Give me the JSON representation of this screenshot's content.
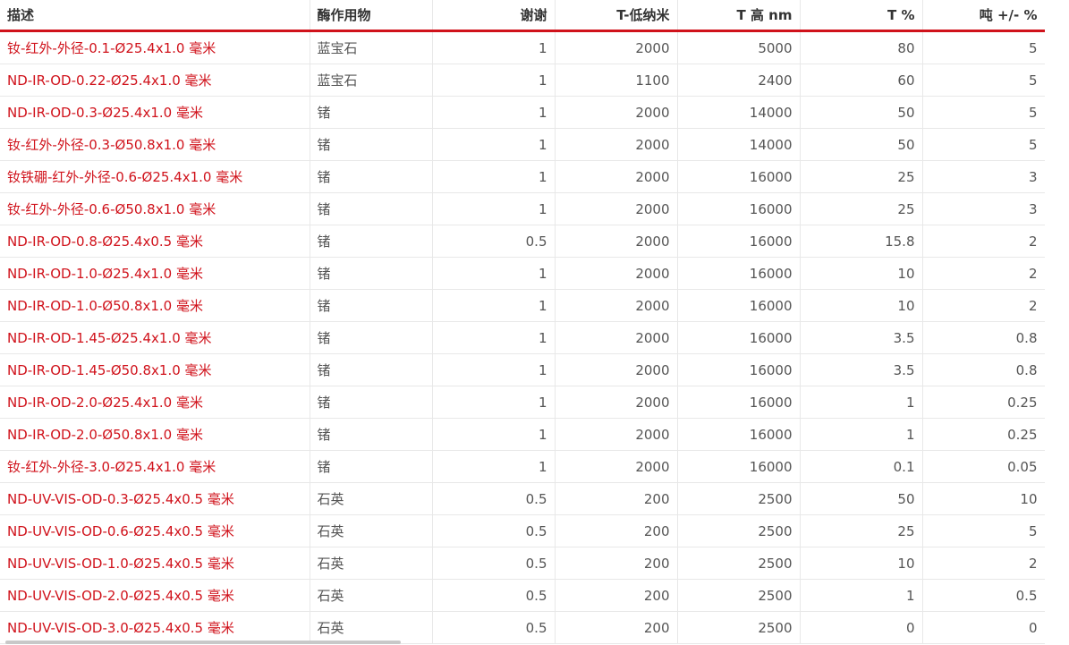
{
  "table": {
    "headers": [
      "描述",
      "酶作用物",
      "谢谢",
      "T-低纳米",
      "T 高 nm",
      "T %",
      "吨 +/- %"
    ],
    "rows": [
      [
        "钕-红外-外径-0.1-Ø25.4x1.0 毫米",
        "蓝宝石",
        "1",
        "2000",
        "5000",
        "80",
        "5"
      ],
      [
        "ND-IR-OD-0.22-Ø25.4x1.0 毫米",
        "蓝宝石",
        "1",
        "1100",
        "2400",
        "60",
        "5"
      ],
      [
        "ND-IR-OD-0.3-Ø25.4x1.0 毫米",
        "锗",
        "1",
        "2000",
        "14000",
        "50",
        "5"
      ],
      [
        "钕-红外-外径-0.3-Ø50.8x1.0 毫米",
        "锗",
        "1",
        "2000",
        "14000",
        "50",
        "5"
      ],
      [
        "钕铁硼-红外-外径-0.6-Ø25.4x1.0 毫米",
        "锗",
        "1",
        "2000",
        "16000",
        "25",
        "3"
      ],
      [
        "钕-红外-外径-0.6-Ø50.8x1.0 毫米",
        "锗",
        "1",
        "2000",
        "16000",
        "25",
        "3"
      ],
      [
        "ND-IR-OD-0.8-Ø25.4x0.5 毫米",
        "锗",
        "0.5",
        "2000",
        "16000",
        "15.8",
        "2"
      ],
      [
        "ND-IR-OD-1.0-Ø25.4x1.0 毫米",
        "锗",
        "1",
        "2000",
        "16000",
        "10",
        "2"
      ],
      [
        "ND-IR-OD-1.0-Ø50.8x1.0 毫米",
        "锗",
        "1",
        "2000",
        "16000",
        "10",
        "2"
      ],
      [
        "ND-IR-OD-1.45-Ø25.4x1.0 毫米",
        "锗",
        "1",
        "2000",
        "16000",
        "3.5",
        "0.8"
      ],
      [
        "ND-IR-OD-1.45-Ø50.8x1.0 毫米",
        "锗",
        "1",
        "2000",
        "16000",
        "3.5",
        "0.8"
      ],
      [
        "ND-IR-OD-2.0-Ø25.4x1.0 毫米",
        "锗",
        "1",
        "2000",
        "16000",
        "1",
        "0.25"
      ],
      [
        "ND-IR-OD-2.0-Ø50.8x1.0 毫米",
        "锗",
        "1",
        "2000",
        "16000",
        "1",
        "0.25"
      ],
      [
        "钕-红外-外径-3.0-Ø25.4x1.0 毫米",
        "锗",
        "1",
        "2000",
        "16000",
        "0.1",
        "0.05"
      ],
      [
        "ND-UV-VIS-OD-0.3-Ø25.4x0.5 毫米",
        "石英",
        "0.5",
        "200",
        "2500",
        "50",
        "10"
      ],
      [
        "ND-UV-VIS-OD-0.6-Ø25.4x0.5 毫米",
        "石英",
        "0.5",
        "200",
        "2500",
        "25",
        "5"
      ],
      [
        "ND-UV-VIS-OD-1.0-Ø25.4x0.5 毫米",
        "石英",
        "0.5",
        "200",
        "2500",
        "10",
        "2"
      ],
      [
        "ND-UV-VIS-OD-2.0-Ø25.4x0.5 毫米",
        "石英",
        "0.5",
        "200",
        "2500",
        "1",
        "0.5"
      ],
      [
        "ND-UV-VIS-OD-3.0-Ø25.4x0.5 毫米",
        "石英",
        "0.5",
        "200",
        "2500",
        "0",
        "0"
      ]
    ]
  },
  "colors": {
    "accent": "#d0121b",
    "text": "#555555",
    "header_text": "#333333",
    "grid": "#e8e8e8"
  }
}
